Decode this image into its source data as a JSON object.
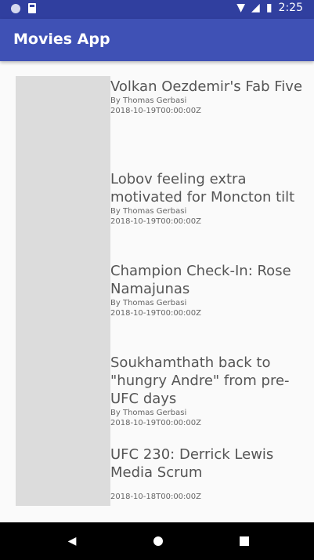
{
  "status_bar": {
    "time": "2:25",
    "wifi_icon": "wifi-icon",
    "signal_icon": "signal-icon",
    "battery_icon": "battery-icon"
  },
  "appbar": {
    "title": "Movies App"
  },
  "articles": [
    {
      "title": "Volkan Oezdemir's Fab Five",
      "author": "By Thomas Gerbasi",
      "date": "2018-10-19T00:00:00Z"
    },
    {
      "title": "Lobov feeling extra motivated for Moncton tilt",
      "author": "By Thomas Gerbasi",
      "date": "2018-10-19T00:00:00Z"
    },
    {
      "title": "Champion Check-In: Rose Namajunas",
      "author": "By Thomas Gerbasi",
      "date": "2018-10-19T00:00:00Z"
    },
    {
      "title": "Soukhamthath back to \"hungry Andre\" from pre-UFC days",
      "author": "By Thomas Gerbasi",
      "date": "2018-10-19T00:00:00Z"
    },
    {
      "title": "UFC 230: Derrick Lewis Media Scrum",
      "author": "",
      "date": "2018-10-18T00:00:00Z"
    }
  ],
  "navigation": {
    "back_icon": "back-icon",
    "home_icon": "home-icon",
    "recent_icon": "recent-apps-icon"
  }
}
